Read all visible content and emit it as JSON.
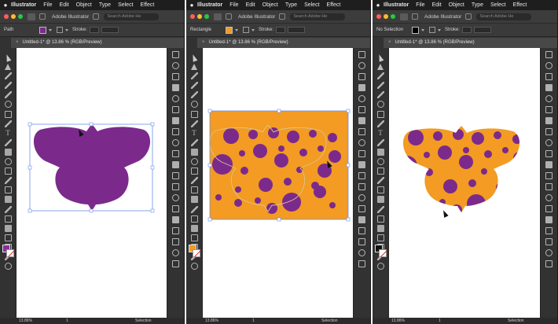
{
  "menu": {
    "app_name": "Illustrator",
    "items": [
      "File",
      "Edit",
      "Object",
      "Type",
      "Select",
      "Effect"
    ]
  },
  "appbar": {
    "title": "Adobe Illustrator",
    "search_placeholder": "Search Adobe He"
  },
  "panels": [
    {
      "selection_type": "Path",
      "fill_color": "#7b2a8c",
      "stroke_label": "Stroke:",
      "doc_tab": "Untitled-1* @ 13.86 % (RGB/Preview)",
      "zoom": "13.86%",
      "page": "1",
      "status_tool": "Selection",
      "fill_swatch": "#8a2f9a"
    },
    {
      "selection_type": "Rectangle",
      "fill_color": "#f39b22",
      "stroke_label": "Stroke:",
      "doc_tab": "Untitled-1* @ 13.86 % (RGB/Preview)",
      "zoom": "13.86%",
      "page": "1",
      "status_tool": "Selection",
      "fill_swatch": "#f39b22"
    },
    {
      "selection_type": "No Selection",
      "fill_color": "#000000",
      "stroke_label": "Stroke:",
      "doc_tab": "Untitled-1* @ 13.86 % (RGB/Preview)",
      "zoom": "13.86%",
      "page": "1",
      "status_tool": "Selection",
      "fill_swatch": "#111111"
    }
  ],
  "colors": {
    "purple": "#7b2a8c",
    "orange": "#f39b22",
    "selection_blue": "#4f7fe0",
    "ui_dark": "#323232"
  },
  "icons": {
    "apple": "apple-logo-icon",
    "selection_tool": "selection-arrow-icon",
    "cursor": "mouse-cursor-icon"
  }
}
